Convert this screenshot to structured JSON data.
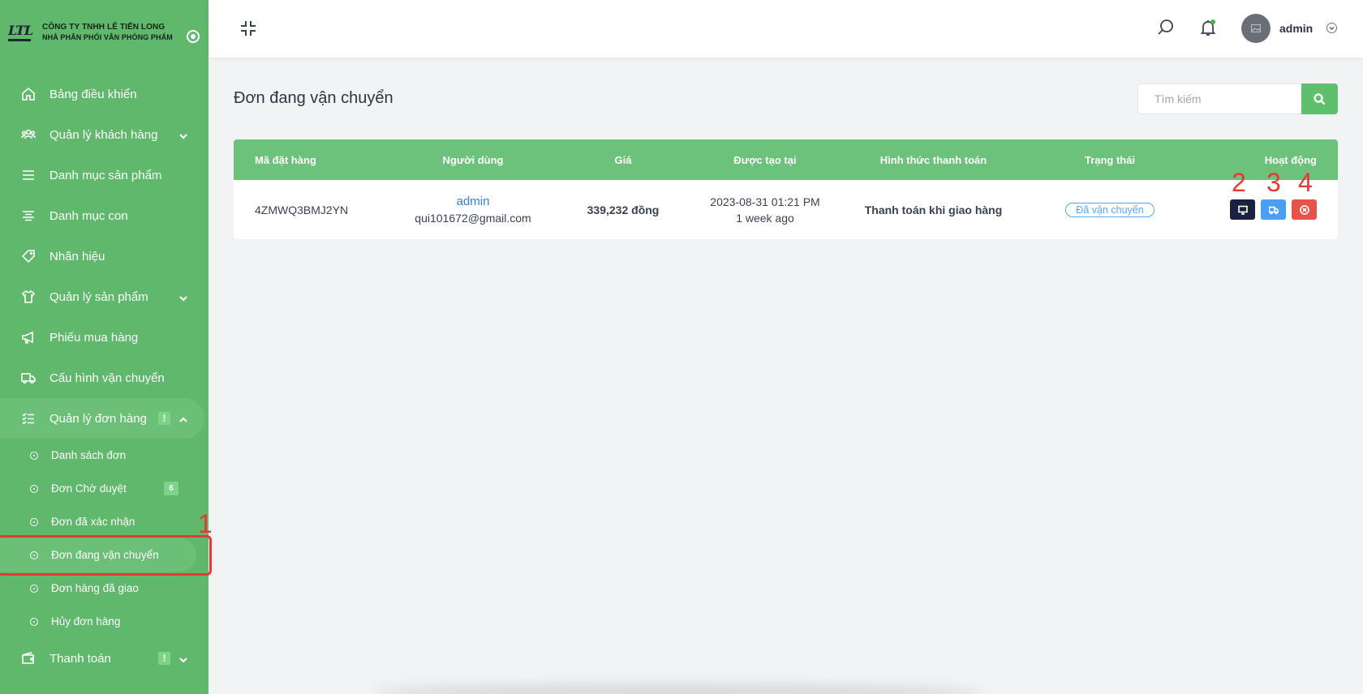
{
  "brand": {
    "logo_text": "LTL",
    "line1": "CÔNG TY TNHH LÊ TIẾN LONG",
    "line2": "NHÀ PHÂN PHỐI VĂN PHÒNG PHẨM"
  },
  "sidebar": {
    "items": [
      {
        "label": "Bảng điều khiển",
        "icon": "home-icon"
      },
      {
        "label": "Quản lý khách hàng",
        "icon": "users-icon"
      },
      {
        "label": "Danh mục sản phẩm",
        "icon": "list-icon"
      },
      {
        "label": "Danh mục con",
        "icon": "align-icon"
      },
      {
        "label": "Nhãn hiệu",
        "icon": "tag-icon"
      },
      {
        "label": "Quản lý sản phẩm",
        "icon": "shirt-icon"
      },
      {
        "label": "Phiếu mua hàng",
        "icon": "megaphone-icon"
      },
      {
        "label": "Cấu hình vận chuyển",
        "icon": "truck-icon"
      },
      {
        "label": "Quản lý đơn hàng",
        "icon": "checklist-icon",
        "badge": "!"
      },
      {
        "label": "Thanh toán",
        "icon": "wallet-icon",
        "badge": "!"
      }
    ],
    "orders_submenu": [
      {
        "label": "Danh sách đơn"
      },
      {
        "label": "Đơn Chờ duyệt",
        "count": "6"
      },
      {
        "label": "Đơn đã xác nhận"
      },
      {
        "label": "Đơn đang vận chuyển"
      },
      {
        "label": "Đơn hàng đã giao"
      },
      {
        "label": "Hủy đơn hàng"
      }
    ]
  },
  "header": {
    "user_name": "admin"
  },
  "page": {
    "title": "Đơn đang vận chuyển",
    "search_placeholder": "Tìm kiếm"
  },
  "table": {
    "columns": [
      "Mã đặt hàng",
      "Người dùng",
      "Giá",
      "Được tạo tại",
      "Hình thức thanh toán",
      "Trạng thái",
      "Hoạt động"
    ],
    "rows": [
      {
        "order_id": "4ZMWQ3BMJ2YN",
        "user_name": "admin",
        "user_email": "qui101672@gmail.com",
        "price": "339,232 đồng",
        "created_at": "2023-08-31 01:21 PM",
        "created_ago": "1 week ago",
        "payment": "Thanh toán khi giao hàng",
        "status": "Đã vận chuyển"
      }
    ]
  },
  "annotations": [
    "1",
    "2",
    "3",
    "4"
  ],
  "colors": {
    "sidebar": "#5fb86b",
    "table_header": "#6cc27a",
    "accent": "#5fbf6d",
    "link": "#2f80ed",
    "status": "#56a8f2",
    "annotation": "#e53935"
  }
}
